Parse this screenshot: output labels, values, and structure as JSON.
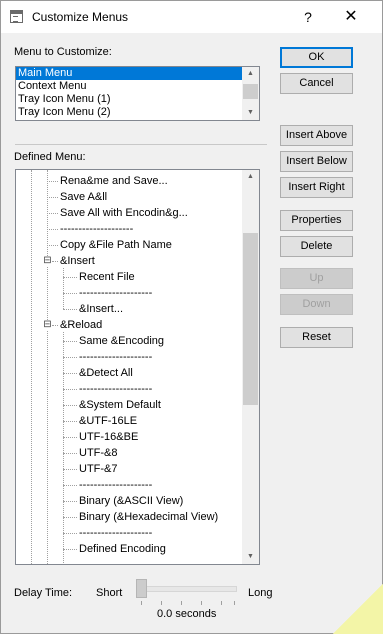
{
  "window": {
    "title": "Customize Menus",
    "help_glyph": "?",
    "close_glyph": "✕"
  },
  "menu_to_customize": {
    "label": "Menu to Customize:",
    "items": [
      {
        "label": "Main Menu",
        "selected": true
      },
      {
        "label": "Context Menu",
        "selected": false
      },
      {
        "label": "Tray Icon Menu (1)",
        "selected": false
      },
      {
        "label": "Tray Icon Menu (2)",
        "selected": false
      }
    ]
  },
  "defined_menu": {
    "label": "Defined Menu:",
    "items": [
      {
        "label": "Rena&me and Save...",
        "level": 2
      },
      {
        "label": "Save A&ll",
        "level": 2
      },
      {
        "label": "Save All with Encodin&g...",
        "level": 2
      },
      {
        "label": "--------------------",
        "level": 2
      },
      {
        "label": "Copy &File Path Name",
        "level": 2
      },
      {
        "label": "&Insert",
        "level": 2,
        "expanded": true
      },
      {
        "label": "Recent File",
        "level": 3
      },
      {
        "label": "--------------------",
        "level": 3
      },
      {
        "label": "&Insert...",
        "level": 3
      },
      {
        "label": "&Reload",
        "level": 2,
        "expanded": true
      },
      {
        "label": "Same &Encoding",
        "level": 3
      },
      {
        "label": "--------------------",
        "level": 3
      },
      {
        "label": "&Detect All",
        "level": 3
      },
      {
        "label": "--------------------",
        "level": 3
      },
      {
        "label": "&System Default",
        "level": 3
      },
      {
        "label": "&UTF-16LE",
        "level": 3
      },
      {
        "label": "UTF-16&BE",
        "level": 3
      },
      {
        "label": "UTF-&8",
        "level": 3
      },
      {
        "label": "UTF-&7",
        "level": 3
      },
      {
        "label": "--------------------",
        "level": 3
      },
      {
        "label": "Binary (&ASCII View)",
        "level": 3
      },
      {
        "label": "Binary (&Hexadecimal View)",
        "level": 3
      },
      {
        "label": "--------------------",
        "level": 3
      },
      {
        "label": "Defined Encoding",
        "level": 3
      }
    ]
  },
  "buttons": {
    "ok": "OK",
    "cancel": "Cancel",
    "insert_above": "Insert Above",
    "insert_below": "Insert Below",
    "insert_right": "Insert Right",
    "properties": "Properties",
    "delete": "Delete",
    "up": "Up",
    "down": "Down",
    "reset": "Reset"
  },
  "delay": {
    "label": "Delay Time:",
    "short_label": "Short",
    "long_label": "Long",
    "value_text": "0.0 seconds",
    "slider_fraction": 0
  },
  "colors": {
    "accent": "#0078d7",
    "dialog_bg": "#f0f0f0"
  }
}
